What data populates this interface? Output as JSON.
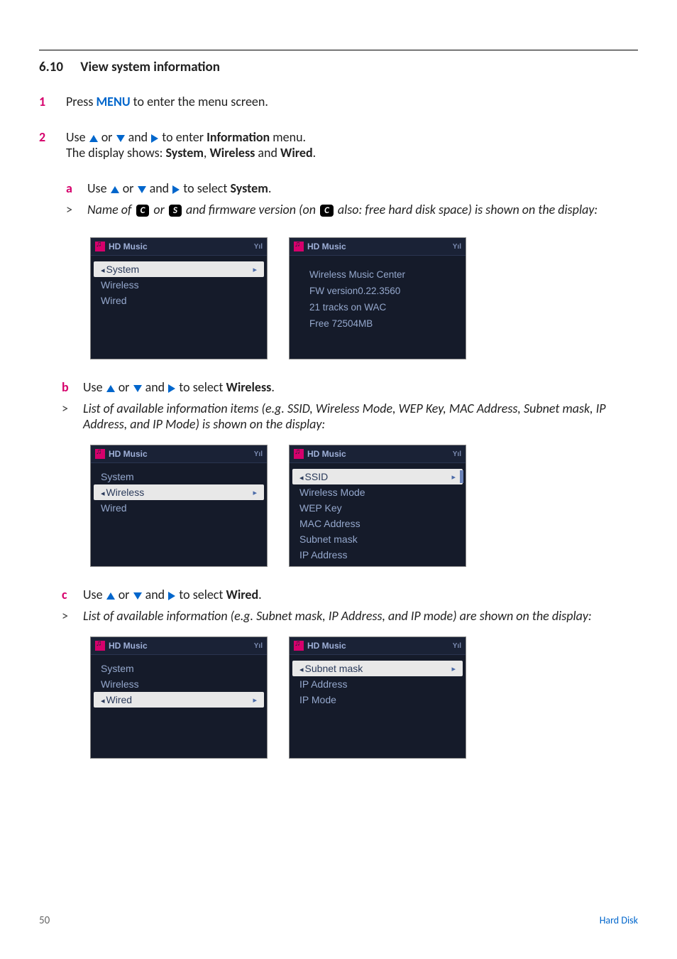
{
  "section": {
    "number": "6.10",
    "title": "View system information"
  },
  "steps": {
    "s1": {
      "num": "1",
      "text_before": "Press ",
      "menu": "MENU",
      "text_after": " to enter the menu screen."
    },
    "s2": {
      "num": "2",
      "line1_a": "Use ",
      "line1_b": " or ",
      "line1_c": " and ",
      "line1_d": " to enter ",
      "line1_target": "Information",
      "line1_e": " menu.",
      "line2_a": "The display shows: ",
      "line2_b1": "System",
      "line2_c": ", ",
      "line2_b2": "Wireless",
      "line2_d": " and ",
      "line2_b3": "Wired",
      "line2_e": "."
    },
    "a": {
      "letter": "a",
      "pre": "Use ",
      "mid1": " or ",
      "mid2": " and ",
      "post": " to select ",
      "target": "System",
      "end": ".",
      "result_a": "Name of ",
      "badge1": "C",
      "result_b": " or ",
      "badge2": "S",
      "result_c": " and firmware version (on ",
      "badge3": "C",
      "result_d": " also: free hard disk space) is shown on the display:"
    },
    "b": {
      "letter": "b",
      "pre": "Use ",
      "mid1": " or ",
      "mid2": " and ",
      "post": " to select ",
      "target": "Wireless",
      "end": ".",
      "result": "List of available information items (e.g. SSID, Wireless Mode, WEP Key, MAC Address, Subnet mask, IP Address, and IP Mode) is shown on the display:"
    },
    "c": {
      "letter": "c",
      "pre": "Use ",
      "mid1": " or ",
      "mid2": " and ",
      "post": " to select ",
      "target": "Wired",
      "end": ".",
      "result": "List of available information (e.g. Subnet mask, IP Address, and IP mode) are shown on the display:"
    }
  },
  "screens": {
    "header": "HD Music",
    "signal": "Yıl",
    "set_a": {
      "left": {
        "items": [
          "System",
          "Wireless",
          "Wired"
        ],
        "selected": 0
      },
      "right": {
        "lines": [
          "Wireless Music Center",
          "FW version0.22.3560",
          "21 tracks on WAC",
          "Free 72504MB"
        ]
      }
    },
    "set_b": {
      "left": {
        "items": [
          "System",
          "Wireless",
          "Wired"
        ],
        "selected": 1
      },
      "right": {
        "items": [
          "SSID",
          "Wireless Mode",
          "WEP Key",
          "MAC Address",
          "Subnet mask",
          "IP Address"
        ],
        "selected": 0,
        "scroll": true
      }
    },
    "set_c": {
      "left": {
        "items": [
          "System",
          "Wireless",
          "Wired"
        ],
        "selected": 2
      },
      "right": {
        "items": [
          "Subnet mask",
          "IP Address",
          "IP Mode"
        ],
        "selected": 0
      }
    }
  },
  "footer": {
    "page": "50",
    "label": "Hard Disk"
  }
}
